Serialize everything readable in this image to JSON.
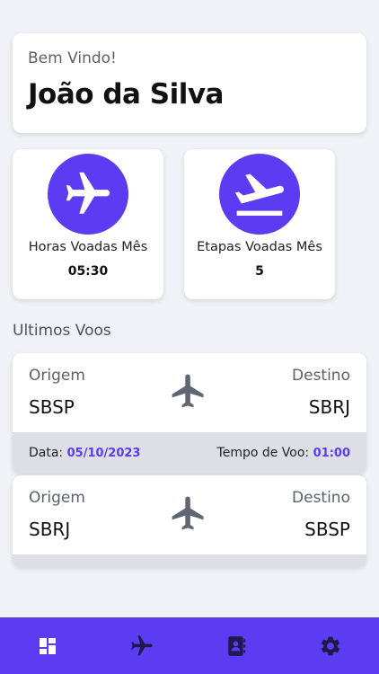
{
  "welcome": {
    "greeting": "Bem Vindo!",
    "name": "João da Silva"
  },
  "stats": [
    {
      "label": "Horas Voadas Mês",
      "value": "05:30",
      "icon": "airplane-icon"
    },
    {
      "label": "Etapas Voadas Mês",
      "value": "5",
      "icon": "airplane-takeoff-icon"
    }
  ],
  "section": {
    "title": "Ultimos Voos"
  },
  "flights": [
    {
      "origin_label": "Origem",
      "origin": "SBSP",
      "dest_label": "Destino",
      "destination": "SBRJ",
      "date_label": "Data:",
      "date": "05/10/2023",
      "time_label": "Tempo de Voo:",
      "time": "01:00"
    },
    {
      "origin_label": "Origem",
      "origin": "SBRJ",
      "dest_label": "Destino",
      "destination": "SBSP"
    }
  ],
  "colors": {
    "accent": "#5b3cf2",
    "background": "#f0f2f7",
    "footer": "#dcdfe5",
    "plane_gray": "#5f6673"
  },
  "nav": [
    {
      "icon": "dashboard-icon"
    },
    {
      "icon": "airplane-icon"
    },
    {
      "icon": "contacts-icon"
    },
    {
      "icon": "gear-icon"
    }
  ]
}
